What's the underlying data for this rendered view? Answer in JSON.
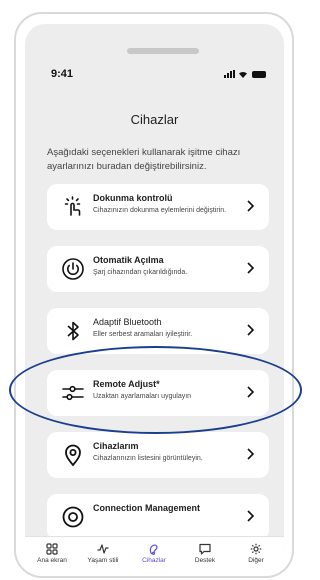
{
  "status": {
    "time": "9:41"
  },
  "header": {
    "title": "Cihazlar"
  },
  "intro": "Aşağıdaki seçenekleri kullanarak işitme cihazı ayarlarınızı buradan değiştirebilirsiniz.",
  "cards": [
    {
      "icon": "touch-control-icon",
      "title": "Dokunma kontrolü",
      "subtitle": "Cihazınızın dokunma eylemlerini değiştirin."
    },
    {
      "icon": "power-icon",
      "title": "Otomatik Açılma",
      "subtitle": "Şarj cihazından çıkarıldığında."
    },
    {
      "icon": "bluetooth-icon",
      "title": "Adaptif Bluetooth",
      "subtitle": "Eller serbest aramaları iyileştirir."
    },
    {
      "icon": "sliders-icon",
      "title": "Remote Adjust*",
      "subtitle": "Uzaktan ayarlamaları uygulayın"
    },
    {
      "icon": "location-pin-icon",
      "title": "Cihazlarım",
      "subtitle": "Cihazlarınızın listesini görüntüleyin."
    },
    {
      "icon": "connection-icon",
      "title": "Connection Management",
      "subtitle": ""
    }
  ],
  "tabs": [
    {
      "icon": "home-grid-icon",
      "label": "Ana ekran"
    },
    {
      "icon": "pulse-icon",
      "label": "Yaşam stili"
    },
    {
      "icon": "hearing-aid-icon",
      "label": "Cihazlar"
    },
    {
      "icon": "chat-bubble-icon",
      "label": "Destek"
    },
    {
      "icon": "gear-icon",
      "label": "Diğer"
    }
  ],
  "colors": {
    "accent": "#5a4fcf",
    "highlight": "#1a3f8f",
    "background": "#ededed"
  }
}
